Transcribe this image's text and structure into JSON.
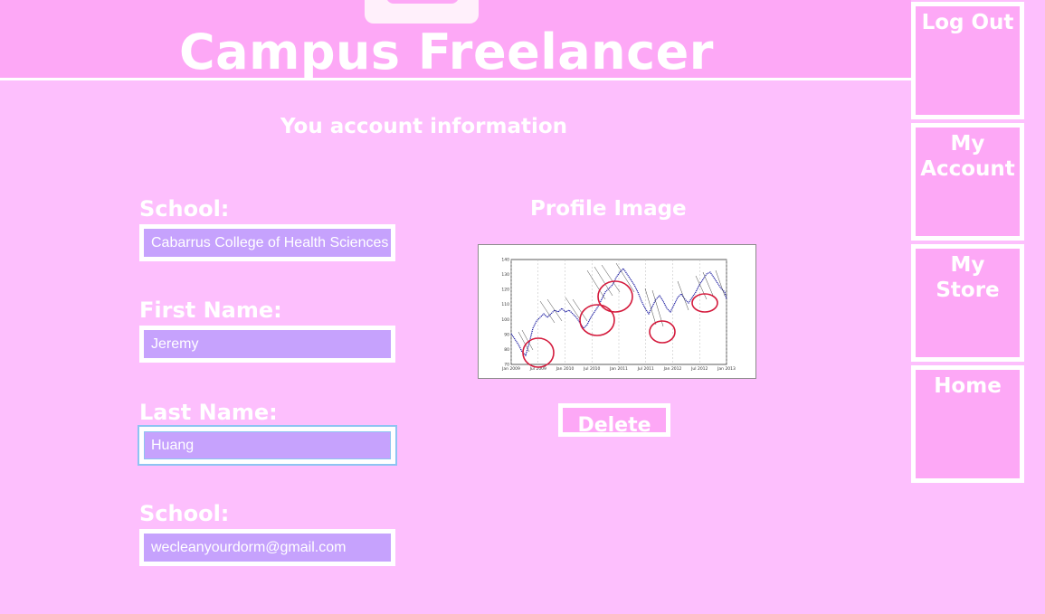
{
  "header": {
    "title": "Campus Freelancer"
  },
  "nav": {
    "items": [
      {
        "label": "Log Out"
      },
      {
        "label": "My\nAccount"
      },
      {
        "label": "My\nStore"
      },
      {
        "label": "Home"
      }
    ]
  },
  "main": {
    "section_title": "You account information",
    "fields": [
      {
        "label": "School:",
        "value": "Cabarrus College of Health Sciences"
      },
      {
        "label": "First Name:",
        "value": "Jeremy"
      },
      {
        "label": "Last Name:",
        "value": "Huang"
      },
      {
        "label": "School:",
        "value": "wecleanyourdorm@gmail.com"
      }
    ],
    "profile_label": "Profile Image",
    "delete_label": "Delete"
  },
  "profile_chart": {
    "x_tick_labels": [
      "Jan 2009",
      "Jul 2009",
      "Jan 2010",
      "Jul 2010",
      "Jan 2011",
      "Jul 2011",
      "Jan 2012",
      "Jul 2012",
      "Jan 2013"
    ],
    "y_tick_labels": [
      "70",
      "80",
      "90",
      "100",
      "110",
      "120",
      "130",
      "140"
    ]
  },
  "colors": {
    "background": "#fdbffd",
    "header": "#fda8f6",
    "input_fill": "#c6a2fd",
    "border": "#ffffff",
    "focus": "#8ec3f2"
  }
}
